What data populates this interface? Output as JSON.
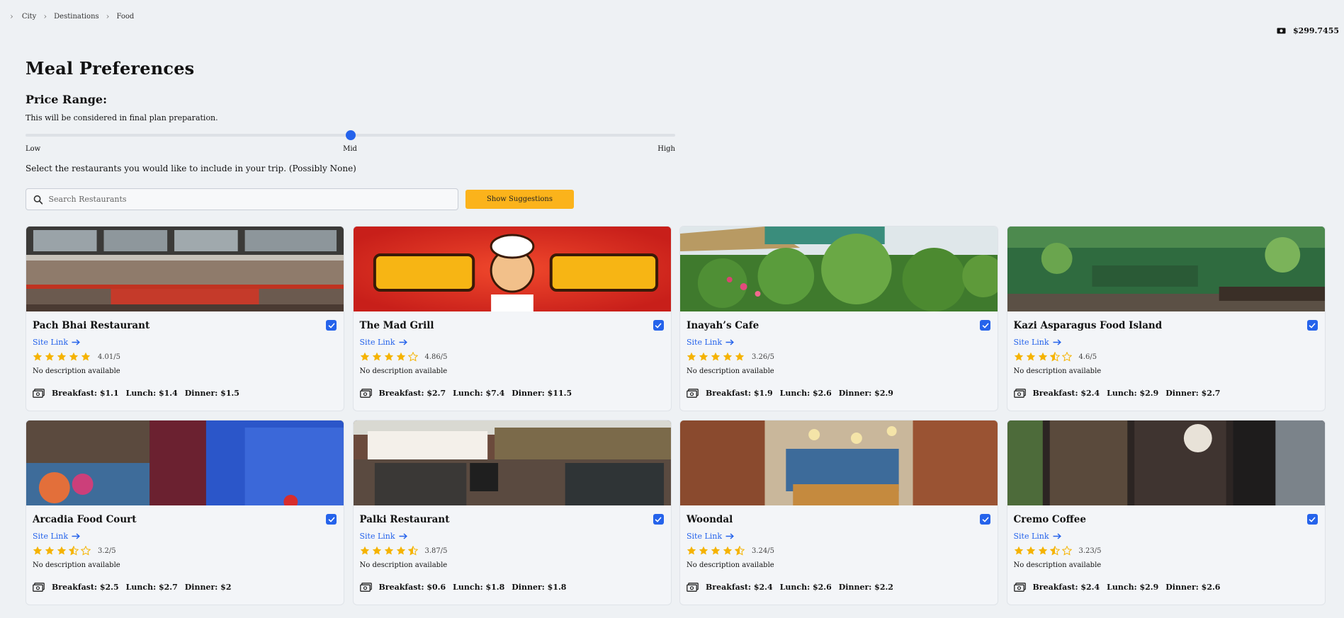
{
  "breadcrumb": [
    "City",
    "Destinations",
    "Food"
  ],
  "budget": "$299.7455",
  "page_title": "Meal Preferences",
  "price_range": {
    "title": "Price Range:",
    "description": "This will be considered in final plan preparation.",
    "level": 0.5,
    "labels": {
      "low": "Low",
      "mid": "Mid",
      "high": "High"
    }
  },
  "select_text": "Select the restaurants you would like to include in your trip. (Possibly None)",
  "search": {
    "placeholder": "Search Restaurants",
    "value": ""
  },
  "suggest_button": "Show Suggestions",
  "colors": {
    "accent": "#2563eb",
    "star": "#f5b301",
    "button": "#fbb31b"
  },
  "restaurants": [
    {
      "name": "Pach Bhai Restaurant",
      "link": "Site Link",
      "rating": 4.01,
      "rating_text": "4.01/5",
      "desc": "No description available",
      "prices": {
        "breakfast": "Breakfast: $1.1",
        "lunch": "Lunch: $1.4",
        "dinner": "Dinner: $1.5"
      },
      "selected": true,
      "image": "building-facade"
    },
    {
      "name": "The Mad Grill",
      "link": "Site Link",
      "rating": 4.86,
      "rating_text": "4.86/5",
      "desc": "No description available",
      "prices": {
        "breakfast": "Breakfast: $2.7",
        "lunch": "Lunch: $7.4",
        "dinner": "Dinner: $11.5"
      },
      "selected": true,
      "image": "mad-grill-logo"
    },
    {
      "name": "Inayah’s Cafe",
      "link": "Site Link",
      "rating": 3.26,
      "rating_text": "3.26/5",
      "desc": "No description available",
      "prices": {
        "breakfast": "Breakfast: $1.9",
        "lunch": "Lunch: $2.6",
        "dinner": "Dinner: $2.9"
      },
      "selected": true,
      "image": "garden"
    },
    {
      "name": "Kazi Asparagus Food Island",
      "link": "Site Link",
      "rating": 4.6,
      "rating_text": "4.6/5",
      "desc": "No description available",
      "prices": {
        "breakfast": "Breakfast: $2.4",
        "lunch": "Lunch: $2.9",
        "dinner": "Dinner: $2.7"
      },
      "selected": true,
      "image": "green-wall"
    },
    {
      "name": "Arcadia Food Court",
      "link": "Site Link",
      "rating": 3.2,
      "rating_text": "3.2/5",
      "desc": "No description available",
      "prices": {
        "breakfast": "Breakfast: $2.5",
        "lunch": "Lunch: $2.7",
        "dinner": "Dinner: $2"
      },
      "selected": true,
      "image": "food-court"
    },
    {
      "name": "Palki Restaurant",
      "link": "Site Link",
      "rating": 3.87,
      "rating_text": "3.87/5",
      "desc": "No description available",
      "prices": {
        "breakfast": "Breakfast: $0.6",
        "lunch": "Lunch: $1.8",
        "dinner": "Dinner: $1.8"
      },
      "selected": true,
      "image": "storefront"
    },
    {
      "name": "Woondal",
      "link": "Site Link",
      "rating": 3.24,
      "rating_text": "3.24/5",
      "desc": "No description available",
      "prices": {
        "breakfast": "Breakfast: $2.4",
        "lunch": "Lunch: $2.6",
        "dinner": "Dinner: $2.2"
      },
      "selected": true,
      "image": "brick-interior"
    },
    {
      "name": "Cremo Coffee",
      "link": "Site Link",
      "rating": 3.23,
      "rating_text": "3.23/5",
      "desc": "No description available",
      "prices": {
        "breakfast": "Breakfast: $2.4",
        "lunch": "Lunch: $2.9",
        "dinner": "Dinner: $2.6"
      },
      "selected": true,
      "image": "glass-door"
    }
  ],
  "card_star_counts": [
    {
      "full": 5,
      "half": 0
    },
    {
      "full": 4,
      "half": 0
    },
    {
      "full": 5,
      "half": 0
    },
    {
      "full": 3,
      "half": 1
    },
    {
      "full": 3,
      "half": 1
    },
    {
      "full": 4,
      "half": 1
    },
    {
      "full": 4,
      "half": 1
    },
    {
      "full": 3,
      "half": 1
    }
  ]
}
